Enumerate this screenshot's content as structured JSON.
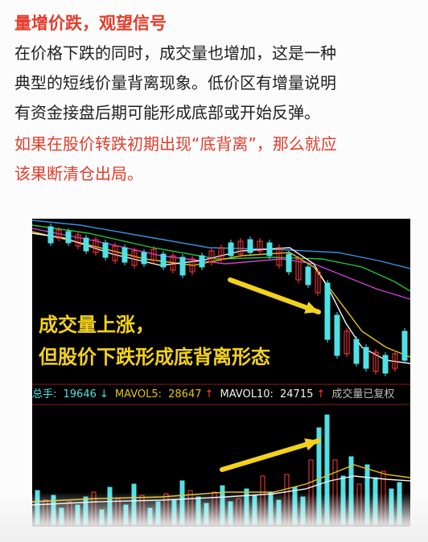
{
  "article": {
    "heading": "量增价跌，观望信号",
    "paragraph1": [
      "在价格下跌的同时，成交量也增加，这是一种",
      "典型的短线价量背离现象。低价区有增量说明",
      "有资金接盘后期可能形成底部或开始反弹。"
    ],
    "paragraph2": [
      "如果在股价转跌初期出现“底背离”，那么就应",
      "该果断清仓出局。"
    ]
  },
  "chart": {
    "annotation_line1": "成交量上涨，",
    "annotation_line2": "但股价下跌形成底背离形态",
    "legend": {
      "total_label": "总手: ",
      "total_value": "19646",
      "mavol5_label": "MAVOL5: ",
      "mavol5_value": "28647",
      "mavol10_label": "MAVOL10: ",
      "mavol10_value": "24715",
      "status": "成交量已复权"
    },
    "colors": {
      "up": "#ff3b3b",
      "down": "#4fe1e6",
      "ma_white": "#f2f2f2",
      "ma_yellow": "#e6c21a",
      "ma_magenta": "#d23fd2",
      "ma_green": "#27c23a",
      "ma_blue": "#3b8ee0",
      "annotation": "#f4d21c"
    }
  }
}
